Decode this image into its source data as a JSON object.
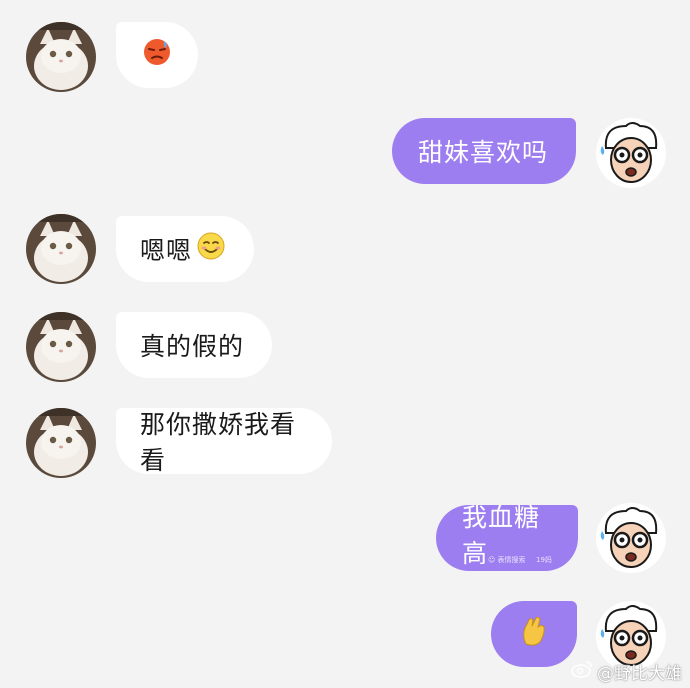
{
  "messages": [
    {
      "id": "m1",
      "side": "incoming",
      "text": "",
      "emoji": "sweating-angry-face-emoji"
    },
    {
      "id": "m2",
      "side": "outgoing",
      "text": "甜妹喜欢吗"
    },
    {
      "id": "m3",
      "side": "incoming",
      "text": "嗯嗯",
      "emoji": "smiling-face-emoji"
    },
    {
      "id": "m4",
      "side": "incoming",
      "text": "真的假的"
    },
    {
      "id": "m5",
      "side": "incoming",
      "text": "那你撒娇我看看"
    },
    {
      "id": "m6",
      "side": "outgoing",
      "text": "我血糖高",
      "caption_left": "☺ 表情搜索",
      "caption_right": "19妈"
    },
    {
      "id": "m7",
      "side": "outgoing",
      "text": "",
      "emoji": "pinching-hand-emoji"
    }
  ],
  "avatars": {
    "incoming": "white-cat-avatar",
    "outgoing": "cartoon-old-man-avatar"
  },
  "watermark": {
    "text": "@野比大雄",
    "icon": "weibo-icon"
  },
  "colors": {
    "background": "#f3f3f3",
    "incoming_bubble": "#ffffff",
    "outgoing_bubble": "#9d7ef0"
  }
}
